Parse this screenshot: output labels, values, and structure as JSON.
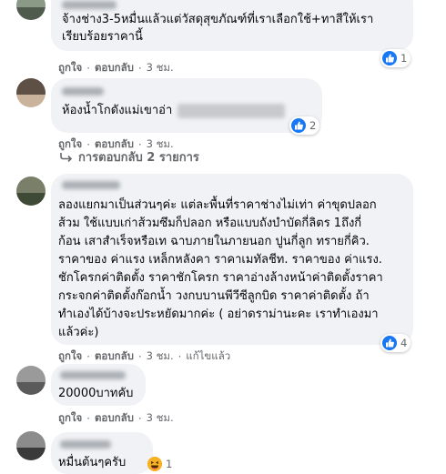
{
  "comments": [
    {
      "text_lines": [
        "จ้างช่าง3-5หมื่นแล้วแต่วัสดุสุขภัณฑ์ที่เราเลือกใช้+ทาสีให้เรา",
        "เรียบร้อยราคานี้"
      ],
      "like_label": "ถูกใจ",
      "reply_label": "ตอบกลับ",
      "time": "3 ชม.",
      "reaction_count": "1"
    },
    {
      "text": "ห้องน้ำโกดังแม่เขาอ่า",
      "like_label": "ถูกใจ",
      "reply_label": "ตอบกลับ",
      "time": "3 ชม.",
      "reaction_count": "2",
      "view_replies": "การตอบกลับ 2 รายการ"
    },
    {
      "text_lines": [
        "ลองแยกมาเป็นส่วนๆค่ะ แต่ละพื้นที่ราคาช่างไม่เท่า ค่าขุดปลอก",
        "ส้วม ใช้แบบเก่าส้วมซึมก็ปลอก หรือแบบถังบำบัดกี่ลิตร 1ถึงกี่",
        "ก้อน เสาสำเร็จหรือเท ฉาบภายในภายนอก ปูนกี่ลูก ทรายกี่คิว.",
        "ราคาของ ค่าแรง เหล็กหลังคา ราคาเมทัลชีท. ราคาของ ค่าแรง.",
        "ชักโครกค่าติดตั้ง ราคาชักโครก ราคาอ่างล้างหน้าค่าติดตั้งราคา",
        "กระจกค่าติดตั้งก๊อกน้ำ วงกบบานพีวีซีลูกบิด ราคาค่าติดตั้ง ถ้า",
        "ทำเองได้บ้างจะประหยัดมากค่ะ ( อย่าดราม่านะคะ เราทำเองมา",
        "แล้วค่ะ)"
      ],
      "like_label": "ถูกใจ",
      "reply_label": "ตอบกลับ",
      "time": "3 ชม.",
      "edited_label": "แก้ไขแล้ว",
      "reaction_count": "4"
    },
    {
      "text": "20000บาทคับ",
      "like_label": "ถูกใจ",
      "reply_label": "ตอบกลับ",
      "time": "3 ชม."
    },
    {
      "text": "หมื่นต้นๆครับ",
      "reaction_count": "1"
    }
  ],
  "separator": "·",
  "colors": {
    "bubble": "#f0f2f5",
    "meta_text": "#65676b",
    "like_blue": "#1877f2",
    "haha_yellow": "#f7b125"
  },
  "icons": [
    "thumbs-up-icon",
    "haha-emoji-icon",
    "reply-arrow-icon"
  ]
}
